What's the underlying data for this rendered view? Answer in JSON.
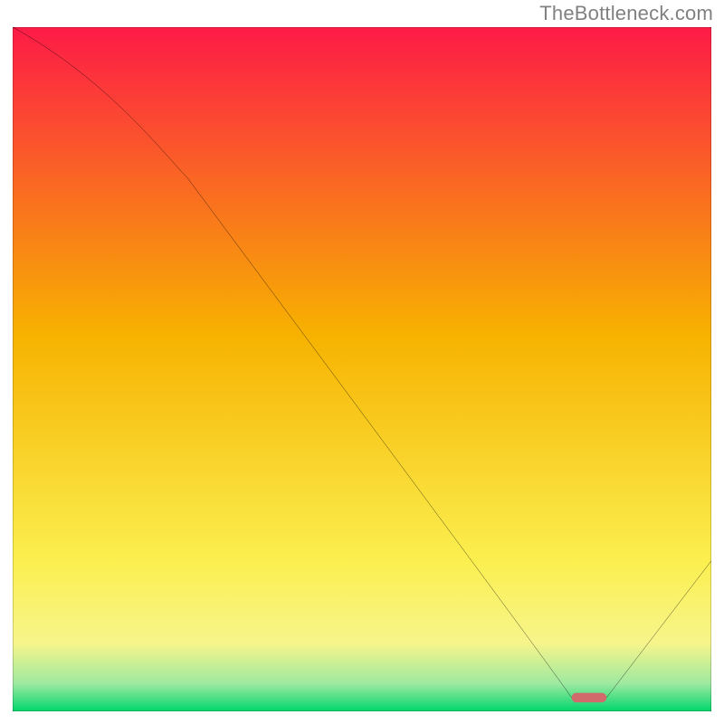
{
  "source": {
    "watermark": "TheBottleneck.com"
  },
  "chart_data": {
    "type": "line",
    "title": "",
    "xlabel": "",
    "ylabel": "",
    "xlim": [
      0,
      100
    ],
    "ylim": [
      0,
      100
    ],
    "grid": false,
    "legend": false,
    "annotations": [],
    "x": [
      0,
      25,
      80,
      85,
      100
    ],
    "values": [
      100,
      78,
      2,
      2,
      22
    ],
    "background_gradient_top": "#fd1b47",
    "background_gradient_mid": "#f7b200",
    "background_gradient_low": "#f7f58b",
    "background_gradient_bottom": "#00d66b",
    "curve_color": "#000000",
    "marker": {
      "x_range": [
        80,
        85
      ],
      "y": 2,
      "color": "#d16a6b"
    }
  },
  "colors": {
    "frame": "#000000",
    "watermark": "#808080"
  }
}
